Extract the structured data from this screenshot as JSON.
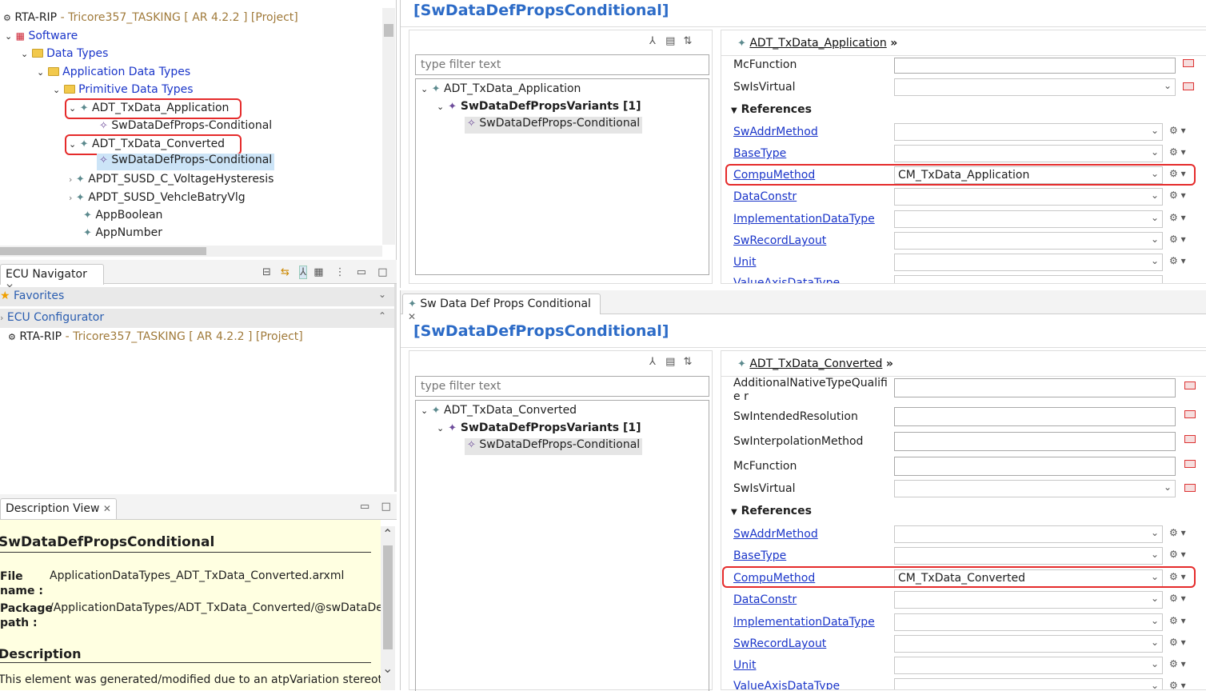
{
  "tree": {
    "root": {
      "name": "RTA-RIP",
      "project": "- Tricore357_TASKING [ AR 4.2.2 ] [Project]"
    },
    "software": "Software",
    "data_types": "Data Types",
    "app_data_types": "Application Data Types",
    "primitive": "Primitive Data Types",
    "adt_app": "ADT_TxData_Application",
    "adt_app_child": "SwDataDefProps-Conditional",
    "adt_conv": "ADT_TxData_Converted",
    "adt_conv_child": "SwDataDefProps-Conditional",
    "apdt1": "APDT_SUSD_C_VoltageHysteresis",
    "apdt2": "APDT_SUSD_VehcleBatryVlg",
    "app_bool": "AppBoolean",
    "app_num": "AppNumber"
  },
  "ecu_nav": {
    "tab": "ECU Navigator",
    "favorites": "Favorites",
    "ecu_config": "ECU Configurator",
    "root_name": "RTA-RIP",
    "root_project": "- Tricore357_TASKING [ AR 4.2.2 ] [Project]"
  },
  "desc": {
    "tab": "Description View",
    "title": "SwDataDefPropsConditional",
    "file_label": "File name :",
    "file_value": "ApplicationDataTypes_ADT_TxData_Converted.arxml",
    "pkg_label": "Package path :",
    "pkg_value": "/ApplicationDataTypes/ADT_TxData_Converted/@swDataDefPro",
    "section": "Description",
    "text": "This element was generated/modified due to an atpVariation stereotype."
  },
  "editor1": {
    "title": "[SwDataDefPropsConditional]",
    "filter_placeholder": "type filter text",
    "tree_root": "ADT_TxData_Application",
    "tree_variants": "SwDataDefPropsVariants [1]",
    "tree_leaf": "SwDataDefProps-Conditional",
    "breadcrumb": "ADT_TxData_Application",
    "props": [
      {
        "label": "McFunction",
        "kind": "input"
      },
      {
        "label": "SwIsVirtual",
        "kind": "combo"
      }
    ],
    "refs_header": "References",
    "refs": [
      {
        "label": "SwAddrMethod",
        "value": ""
      },
      {
        "label": "BaseType",
        "value": ""
      },
      {
        "label": "CompuMethod",
        "value": "CM_TxData_Application"
      },
      {
        "label": "DataConstr",
        "value": ""
      },
      {
        "label": "ImplementationDataType",
        "value": ""
      },
      {
        "label": "SwRecordLayout",
        "value": ""
      },
      {
        "label": "Unit",
        "value": ""
      },
      {
        "label": "ValueAxisDataType",
        "value": ""
      }
    ]
  },
  "editor2": {
    "tab": "Sw Data Def Props Conditional",
    "title": "[SwDataDefPropsConditional]",
    "filter_placeholder": "type filter text",
    "tree_root": "ADT_TxData_Converted",
    "tree_variants": "SwDataDefPropsVariants [1]",
    "tree_leaf": "SwDataDefProps-Conditional",
    "breadcrumb": "ADT_TxData_Converted",
    "props": [
      {
        "label": "AdditionalNativeTypeQualifie r"
      },
      {
        "label": "SwIntendedResolution"
      },
      {
        "label": "SwInterpolationMethod"
      },
      {
        "label": "McFunction"
      },
      {
        "label": "SwIsVirtual"
      }
    ],
    "refs_header": "References",
    "refs": [
      {
        "label": "SwAddrMethod",
        "value": ""
      },
      {
        "label": "BaseType",
        "value": ""
      },
      {
        "label": "CompuMethod",
        "value": "CM_TxData_Converted"
      },
      {
        "label": "DataConstr",
        "value": ""
      },
      {
        "label": "ImplementationDataType",
        "value": ""
      },
      {
        "label": "SwRecordLayout",
        "value": ""
      },
      {
        "label": "Unit",
        "value": ""
      },
      {
        "label": "ValueAxisDataType",
        "value": ""
      }
    ]
  }
}
